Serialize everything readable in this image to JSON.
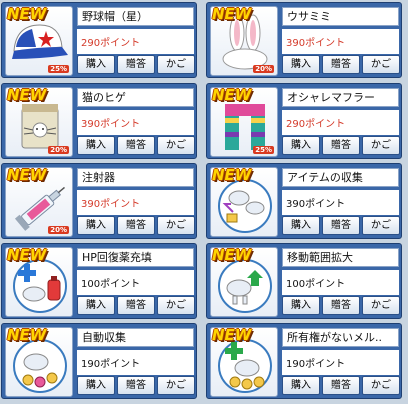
{
  "items": [
    {
      "name": "野球帽（星）",
      "price": "290ポイント",
      "sale": true,
      "discount": "25%",
      "icon": "baseball-cap-icon",
      "new": "NEW"
    },
    {
      "name": "ウサミミ",
      "price": "390ポイント",
      "sale": true,
      "discount": "20%",
      "icon": "bunny-ears-icon",
      "new": "NEW"
    },
    {
      "name": "猫のヒゲ",
      "price": "390ポイント",
      "sale": true,
      "discount": "20%",
      "icon": "cat-whiskers-icon",
      "new": "NEW"
    },
    {
      "name": "オシャレマフラー",
      "price": "290ポイント",
      "sale": true,
      "discount": "25%",
      "icon": "fashion-scarf-icon",
      "new": "NEW"
    },
    {
      "name": "注射器",
      "price": "390ポイント",
      "sale": true,
      "discount": "20%",
      "icon": "syringe-icon",
      "new": "NEW"
    },
    {
      "name": "アイテムの収集",
      "price": "390ポイント",
      "sale": false,
      "discount": "",
      "icon": "item-collect-icon",
      "new": "NEW"
    },
    {
      "name": "HP回復薬充填",
      "price": "100ポイント",
      "sale": false,
      "discount": "",
      "icon": "hp-potion-refill-icon",
      "new": "NEW"
    },
    {
      "name": "移動範囲拡大",
      "price": "100ポイント",
      "sale": false,
      "discount": "",
      "icon": "range-expand-icon",
      "new": "NEW"
    },
    {
      "name": "自動収集",
      "price": "190ポイント",
      "sale": false,
      "discount": "",
      "icon": "auto-collect-icon",
      "new": "NEW"
    },
    {
      "name": "所有権がないメル..",
      "price": "190ポイント",
      "sale": false,
      "discount": "",
      "icon": "unowned-meso-icon",
      "new": "NEW"
    }
  ],
  "buttons": {
    "buy": "購入",
    "gift": "贈答",
    "cart": "かご"
  },
  "colors": {
    "panel": "#3a67a8",
    "sale_price": "#d43a2a",
    "new_badge": "#ffd400",
    "discount_badge": "#d93a20"
  }
}
